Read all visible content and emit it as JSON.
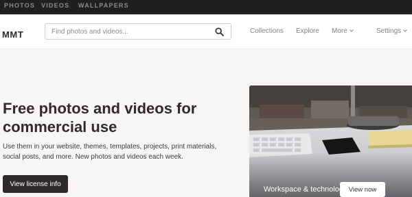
{
  "top_nav": {
    "photos": "PHOTOS",
    "videos": "VIDEOS",
    "wallpapers": "WALLPAPERS"
  },
  "header": {
    "logo": "MMT",
    "search_placeholder": "Find photos and videos...",
    "search_icon": "search-icon",
    "collections": "Collections",
    "explore": "Explore",
    "more": "More",
    "settings": "Settings"
  },
  "hero": {
    "title": "Free photos and videos for commercial use",
    "subtitle": "Use them in your website, themes, templates, projects, print materials, social posts, and more. New photos and videos each week.",
    "license_button": "View license info"
  },
  "featured": {
    "caption": "Workspace & technology",
    "button": "View now"
  },
  "colors": {
    "topbar_bg": "#1f1f1f",
    "page_bg": "#f7f6f5",
    "primary_button": "#2f2a2a",
    "text_dark": "#2f2b2b"
  }
}
